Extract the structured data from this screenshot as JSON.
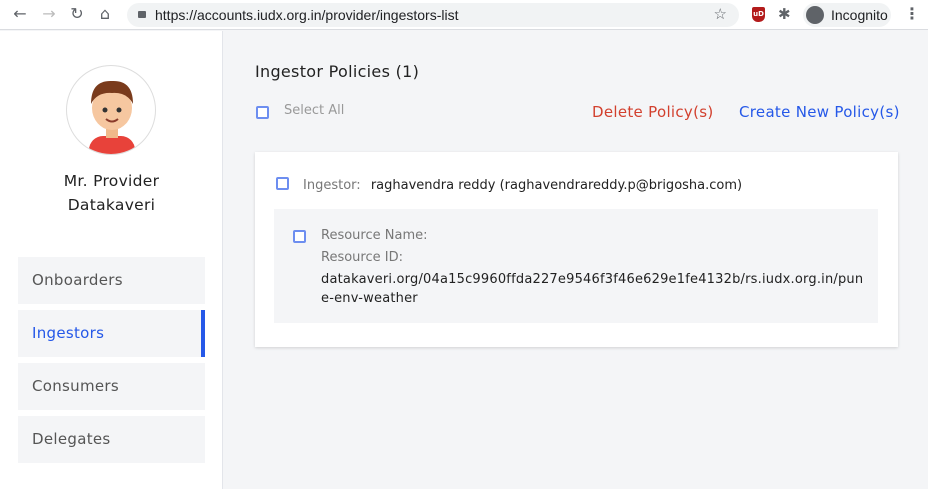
{
  "browser": {
    "url": "https://accounts.iudx.org.in/provider/ingestors-list",
    "profile": "Incognito",
    "ext_badge": "uD"
  },
  "sidebar": {
    "name_line1": "Mr. Provider",
    "name_line2": "Datakaveri",
    "items": [
      {
        "label": "Onboarders"
      },
      {
        "label": "Ingestors",
        "active": true
      },
      {
        "label": "Consumers"
      },
      {
        "label": "Delegates"
      }
    ],
    "accent": "#2558e8"
  },
  "main": {
    "title": "Ingestor Policies (1)",
    "select_all": "Select All",
    "delete": "Delete Policy(s)",
    "create": "Create New Policy(s)",
    "policies": [
      {
        "ingestor_label": "Ingestor:",
        "ingestor": "raghavendra reddy (raghavendrareddy.p@brigosha.com)",
        "resource_name_label": "Resource Name:",
        "resource_id_label": "Resource ID:",
        "resource_id": "datakaveri.org/04a15c9960ffda227e9546f3f46e629e1fe4132b/rs.iudx.org.in/pune-env-weather"
      }
    ]
  }
}
